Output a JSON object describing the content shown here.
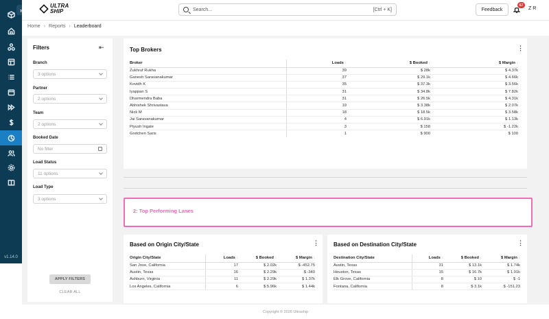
{
  "app": {
    "logo_line1": "ULTRA",
    "logo_line2": "SHIP",
    "version": "v1.14.0"
  },
  "search": {
    "placeholder": "Search...",
    "shortcut": "[Ctrl + K]"
  },
  "header": {
    "feedback_label": "Feedback",
    "notification_count": "67",
    "user_initials": "Z R"
  },
  "rail": {
    "icons": [
      "box-icon",
      "home-icon",
      "network-icon",
      "layout-icon",
      "list-icon",
      "calendar-icon",
      "fast-forward-icon",
      "dollar-icon",
      "pie-chart-icon",
      "users-icon",
      "settings-icon",
      "book-icon"
    ]
  },
  "breadcrumb": {
    "home": "Home",
    "reports": "Reports",
    "current": "Leaderboard"
  },
  "filters": {
    "title": "Filters",
    "groups": [
      {
        "label": "Branch",
        "value": "3 options"
      },
      {
        "label": "Partner",
        "value": "2 options"
      },
      {
        "label": "Team",
        "value": "2 options"
      },
      {
        "label": "Booked Date",
        "value": "No filter"
      },
      {
        "label": "Load Status",
        "value": "11 options"
      },
      {
        "label": "Load Type",
        "value": "3 options"
      }
    ],
    "apply_label": "APPLY FILTERS",
    "clear_label": "CLEAR ALL"
  },
  "top_brokers": {
    "title": "Top Brokers",
    "columns": [
      "Broker",
      "Loads",
      "$ Booked",
      "$ Margin"
    ],
    "rows": [
      [
        "Zukhruf Rukha",
        "39",
        "$ 28k",
        "$ 4.37k"
      ],
      [
        "Ganesh Saravanakumar",
        "37",
        "$ 29.1k",
        "$ 4.66k"
      ],
      [
        "Kovidh K",
        "35",
        "$ 37.3k",
        "$ 3.56k"
      ],
      [
        "Iyappan S",
        "31",
        "$ 34.8k",
        "$ 7.82k"
      ],
      [
        "Dharmendra Baba",
        "31",
        "$ 26.5k",
        "$ 4.31k"
      ],
      [
        "Abhishek Shrivastava",
        "19",
        "$ 3.38k",
        "$ 2.07k"
      ],
      [
        "Nick M",
        "18",
        "$ 18.5k",
        "$ 3.58k"
      ],
      [
        "Jai Saravanakumar",
        "4",
        "$ 6.91k",
        "$ 1.13k"
      ],
      [
        "Piyush Ingale",
        "3",
        "$ 158",
        "$ -1.22k"
      ],
      [
        "Gretchen Saris",
        "1",
        "$ 900",
        "$ 100"
      ]
    ]
  },
  "lanes_section": {
    "title": "2: Top Performing Lanes"
  },
  "origin": {
    "title": "Based on Origin City/State",
    "columns": [
      "Origin City/State",
      "Loads",
      "$ Booked",
      "$ Margin"
    ],
    "rows": [
      [
        "San Jose, California",
        "17",
        "$ 2.02k",
        "$ -452.75"
      ],
      [
        "Austin, Texas",
        "16",
        "$ 2.29k",
        "$ -340"
      ],
      [
        "Ashburn, Virginia",
        "11",
        "$ 2.29k",
        "$ 1.37k"
      ],
      [
        "Los Angeles, California",
        "6",
        "$ 5.96k",
        "$ 1.44k"
      ]
    ]
  },
  "destination": {
    "title": "Based on Destination City/State",
    "columns": [
      "Destination City/State",
      "Loads",
      "$ Booked",
      "$ Margin"
    ],
    "rows": [
      [
        "Austin, Texas",
        "31",
        "$ 13.1k",
        "$ 1.74k"
      ],
      [
        "Houston, Texas",
        "15",
        "$ 16.7k",
        "$ 1.91k"
      ],
      [
        "Elk Grove, California",
        "8",
        "$ 10",
        "$ -1"
      ],
      [
        "Fontana, California",
        "8",
        "$ 3.1k",
        "$ -151.23"
      ]
    ]
  },
  "footer": {
    "text": "Copyright © 2026 Ultraship"
  }
}
